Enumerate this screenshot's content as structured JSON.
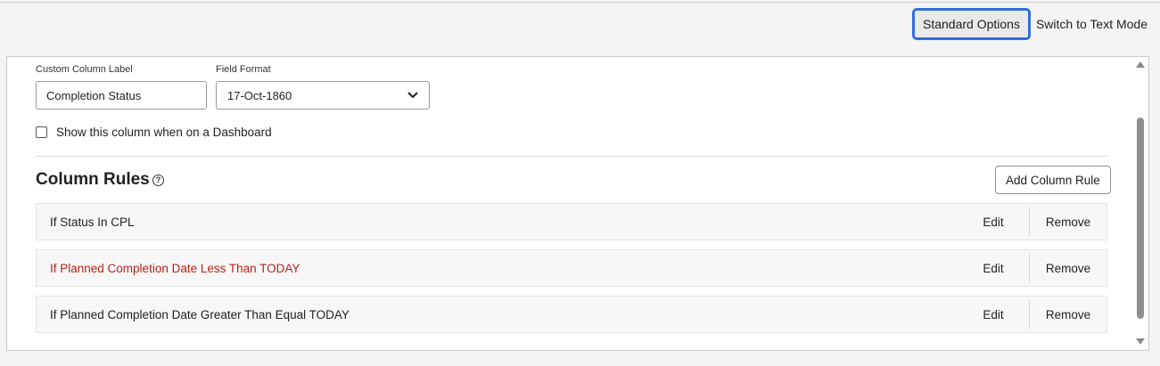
{
  "toolbar": {
    "standard_options": "Standard Options",
    "switch_text_mode": "Switch to Text Mode"
  },
  "form": {
    "custom_label_caption": "Custom Column Label",
    "custom_label_value": "Completion Status",
    "field_format_caption": "Field Format",
    "field_format_value": "17-Oct-1860",
    "dashboard_checkbox_label": "Show this column when on a Dashboard",
    "dashboard_checkbox_checked": false
  },
  "column_rules": {
    "title": "Column Rules",
    "help_icon": "?",
    "add_button": "Add Column Rule",
    "rules": [
      {
        "text": "If Status In CPL",
        "color": "#1f1f1f",
        "edit": "Edit",
        "remove": "Remove"
      },
      {
        "text": "If Planned Completion Date Less Than TODAY",
        "color": "#b42318",
        "edit": "Edit",
        "remove": "Remove"
      },
      {
        "text": "If Planned Completion Date Greater Than Equal TODAY",
        "color": "#1f1f1f",
        "edit": "Edit",
        "remove": "Remove"
      }
    ]
  },
  "colors": {
    "accent": "#2f6fde",
    "warning_text": "#b42318"
  }
}
